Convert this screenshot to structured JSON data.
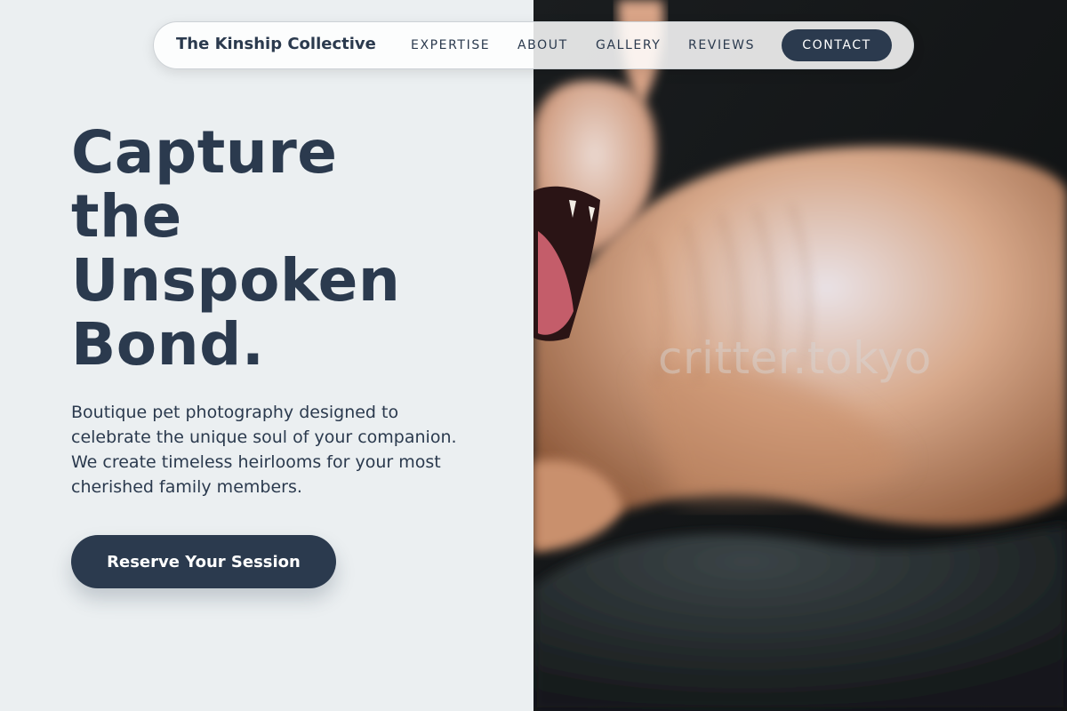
{
  "nav": {
    "brand": "The Kinship Collective",
    "links": [
      "EXPERTISE",
      "ABOUT",
      "GALLERY",
      "REVIEWS"
    ],
    "contact_label": "CONTACT"
  },
  "hero": {
    "headline_lines": [
      "Capture",
      "the",
      "Unspoken",
      "Bond."
    ],
    "subtext": "Boutique pet photography designed to celebrate the unique soul of your companion. We create timeless heirlooms for your most cherished family members.",
    "cta_label": "Reserve Your Session"
  },
  "photo": {
    "watermark": "critter.tokyo"
  },
  "colors": {
    "primary": "#2b3a4e",
    "background": "#ebeff1",
    "photo_bg": "#131618"
  }
}
